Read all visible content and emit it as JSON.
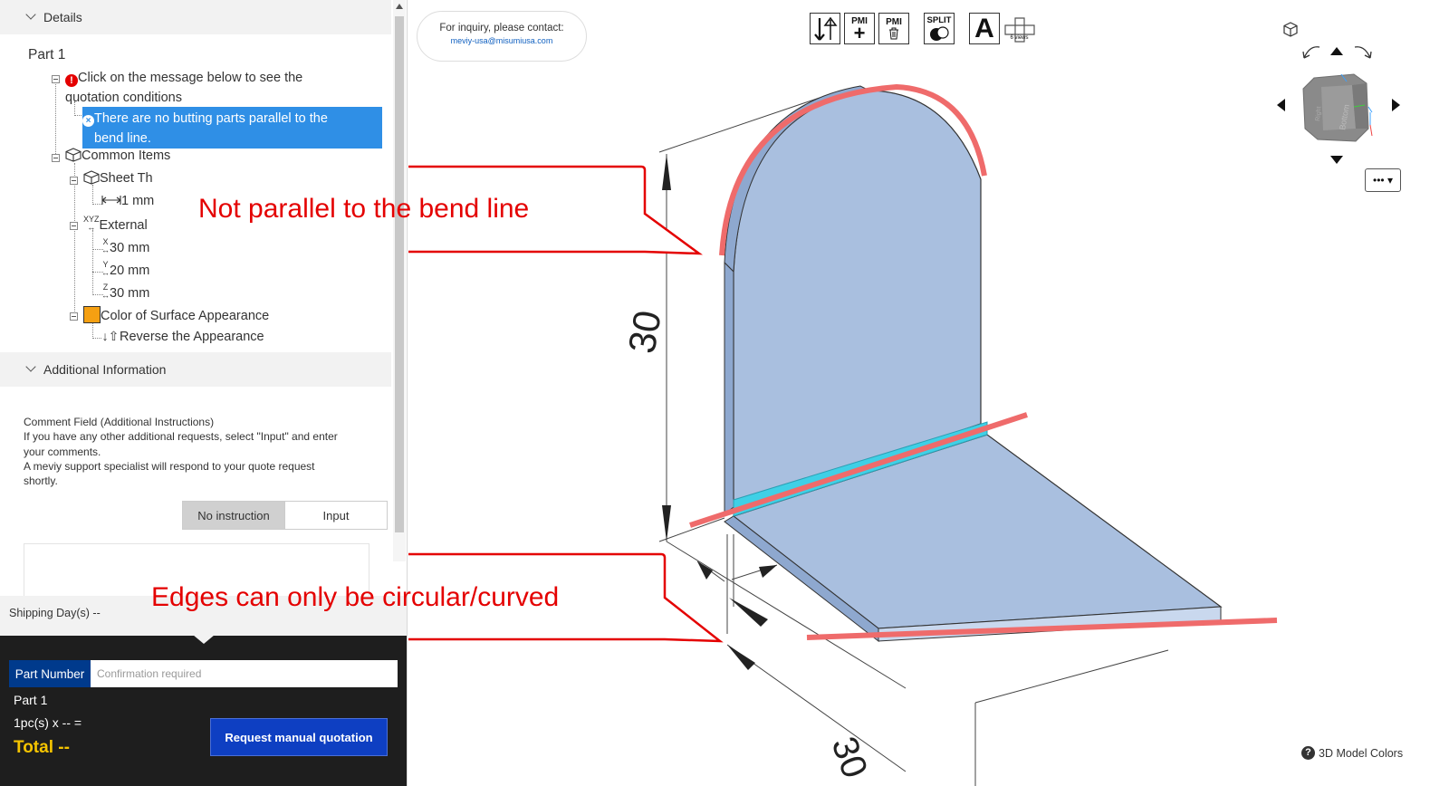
{
  "details": {
    "header": "Details",
    "part_title": "Part 1",
    "error_message": "Click on the message below to see the",
    "error_message_2": "quotation conditions",
    "error_icon_glyph": "!",
    "selected_error_1": "There are no butting parts parallel to the",
    "selected_error_2": "bend line.",
    "selected_icon_glyph": "×",
    "common_items": "Common Items",
    "sheet_thickness": "Sheet Th",
    "thickness_value": "1 mm",
    "external": "External",
    "xyz_label": "XYZ",
    "x_axis": "X",
    "y_axis": "Y",
    "z_axis": "Z",
    "x_value": "30 mm",
    "y_value": "20 mm",
    "z_value": "30 mm",
    "color_surface": "Color of Surface Appearance",
    "reverse": "Reverse the Appearance",
    "swatch_color": "#f5a012"
  },
  "additional": {
    "header": "Additional Information",
    "comment_title": "Comment Field (Additional Instructions)",
    "line1": "If you have any other additional requests, select \"Input\" and enter",
    "line2": "your comments.",
    "line3": "A meviy support specialist will respond to your quote request",
    "line4": "shortly.",
    "no_instruction": "No instruction",
    "input": "Input"
  },
  "footer": {
    "shipping": "Shipping Day(s) --",
    "part_number_label": "Part Number",
    "part_number_placeholder": "Confirmation required",
    "part_name": "Part 1",
    "quantity": "1pc(s)  x -- =",
    "total": "Total --",
    "request_button": "Request manual quotation",
    "button_color": "#0e3fc2",
    "total_color": "#f5c400"
  },
  "viewer": {
    "inquiry_line1": "For inquiry, please contact:",
    "inquiry_email": "meviy-usa@misumiusa.com",
    "toolbar": {
      "pmi": "PMI",
      "split": "SPLIT",
      "font_glyph": "A",
      "views_label": "6 views"
    },
    "nav_cube_face_front": "Bottom",
    "nav_cube_face_side": "Right",
    "more_button": "••• ▾",
    "model_colors": "3D Model Colors",
    "help_glyph": "?",
    "dimension_30_vertical": "30",
    "dimension_30_bottom": "30",
    "model_fill": "#a9bfdf",
    "bend_line_color": "#3fd0e6",
    "highlight_color": "#ef6b6b"
  },
  "callouts": {
    "callout1": "Not parallel to the bend line",
    "callout2": "Edges can only be circular/curved",
    "color": "#e40000"
  }
}
